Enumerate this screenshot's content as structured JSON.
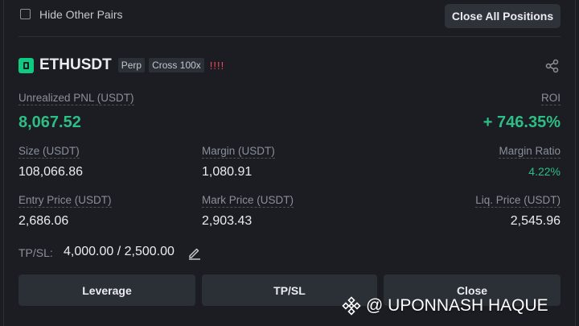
{
  "toolbar": {
    "hide_label": "Hide Other Pairs",
    "close_all_label": "Close All Positions"
  },
  "position": {
    "symbol": "ETHUSDT",
    "tag_type": "Perp",
    "tag_margin": "Cross 100x",
    "risk_indicator": "!!!!",
    "pnl_label": "Unrealized PNL (USDT)",
    "pnl_value": "8,067.52",
    "roi_label": "ROI",
    "roi_value": "+ 746.35%",
    "size_label": "Size (USDT)",
    "size_value": "108,066.86",
    "margin_label": "Margin (USDT)",
    "margin_value": "1,080.91",
    "margin_ratio_label": "Margin Ratio",
    "margin_ratio_value": "4.22%",
    "entry_label": "Entry Price (USDT)",
    "entry_value": "2,686.06",
    "mark_label": "Mark Price (USDT)",
    "mark_value": "2,903.43",
    "liq_label": "Liq. Price (USDT)",
    "liq_value": "2,545.96",
    "tpsl_label": "TP/SL:",
    "tpsl_value": "4,000.00 / 2,500.00"
  },
  "actions": {
    "leverage": "Leverage",
    "tpsl": "TP/SL",
    "close": "Close"
  },
  "watermark": {
    "text": "@ UPONNASH HAQUE"
  },
  "colors": {
    "background": "#1b1d23",
    "green": "#2ebd85",
    "red": "#f6465d",
    "button": "#2b2f36"
  }
}
